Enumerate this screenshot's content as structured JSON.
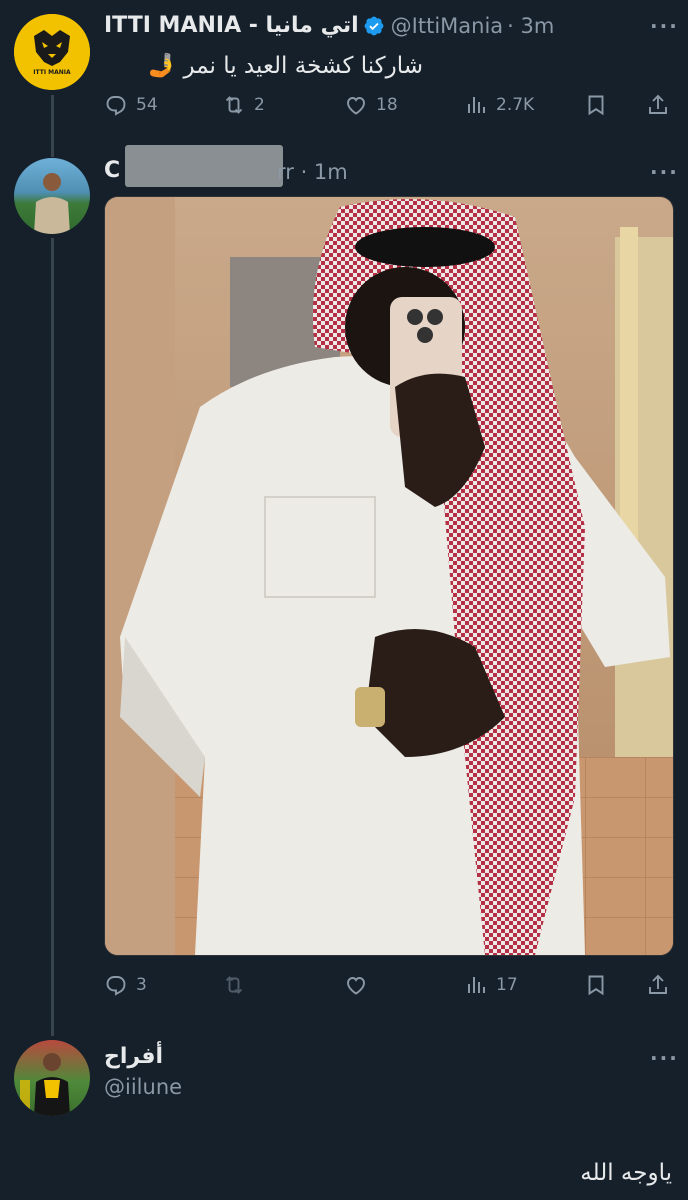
{
  "tweet1": {
    "display_name": "ITTI MANIA - اتي مانيا",
    "handle": "@IttiMania",
    "time": "· 3m",
    "text": "شاركنا كشخة العيد يا نمر 🤳",
    "avatar_text": "ITTI MANIA",
    "stats": {
      "replies": "54",
      "retweets": "2",
      "likes": "18",
      "views": "2.7K"
    }
  },
  "tweet2": {
    "display_name_visible": "C",
    "meta_visible": "rr · 1m",
    "stats": {
      "replies": "3",
      "views": "17"
    }
  },
  "tweet3": {
    "display_name": "أفراح",
    "handle": "@iilune",
    "text": "ياوجه الله"
  },
  "icons": {
    "more": "more-horizontal-icon",
    "reply": "reply-icon",
    "retweet": "retweet-icon",
    "like": "heart-icon",
    "views": "views-icon",
    "bookmark": "bookmark-icon",
    "share": "share-icon",
    "verified": "verified-badge-icon"
  },
  "colors": {
    "background": "#15202b",
    "text": "#e7e9ea",
    "secondary": "#8b98a5",
    "verified": "#1d9bf0",
    "avatar_gold": "#f2c200"
  }
}
